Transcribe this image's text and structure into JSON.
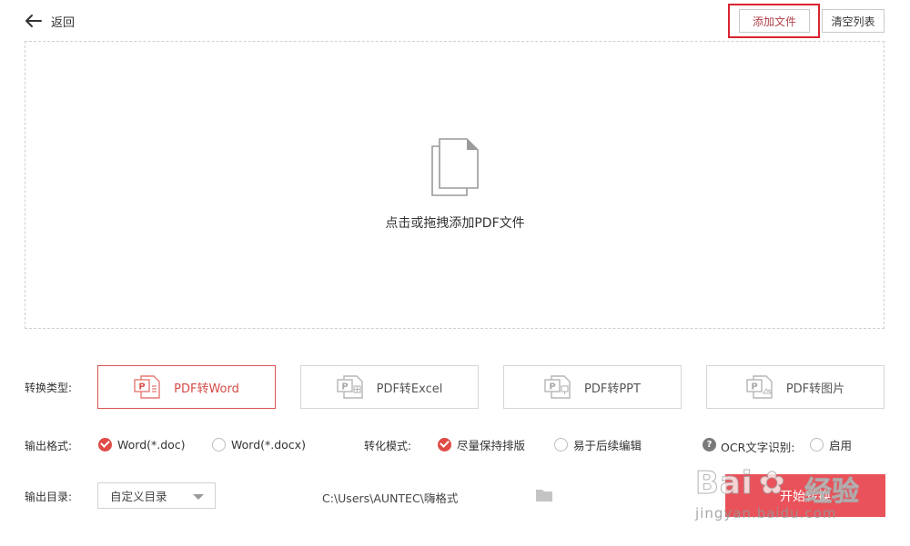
{
  "header": {
    "back_label": "返回",
    "add_file_label": "添加文件",
    "clear_list_label": "清空列表"
  },
  "dropzone": {
    "hint": "点击或拖拽添加PDF文件"
  },
  "conversion": {
    "label": "转换类型:",
    "options": [
      {
        "label": "PDF转Word",
        "active": true
      },
      {
        "label": "PDF转Excel",
        "active": false
      },
      {
        "label": "PDF转PPT",
        "active": false
      },
      {
        "label": "PDF转图片",
        "active": false
      }
    ]
  },
  "output_format": {
    "label": "输出格式:",
    "options": [
      {
        "label": "Word(*.doc)",
        "selected": true
      },
      {
        "label": "Word(*.docx)",
        "selected": false
      }
    ]
  },
  "conversion_mode": {
    "label": "转化模式:",
    "options": [
      {
        "label": "尽量保持排版",
        "selected": true
      },
      {
        "label": "易于后续编辑",
        "selected": false
      }
    ]
  },
  "ocr": {
    "help_icon": "?",
    "label": "OCR文字识别:",
    "option_label": "启用",
    "enabled": false
  },
  "output_dir": {
    "label": "输出目录:",
    "select_value": "自定义目录",
    "path": "C:\\Users\\AUNTEC\\嗨格式"
  },
  "start_button": {
    "label": "开始转换"
  },
  "watermark": {
    "brand": "Bai",
    "paw": "✿",
    "brand_cn": "经验",
    "url": "jingyan.baidu.com"
  },
  "colors": {
    "accent": "#e04b46",
    "start_button_bg": "#e9525a",
    "highlight_border": "#d9242f"
  }
}
